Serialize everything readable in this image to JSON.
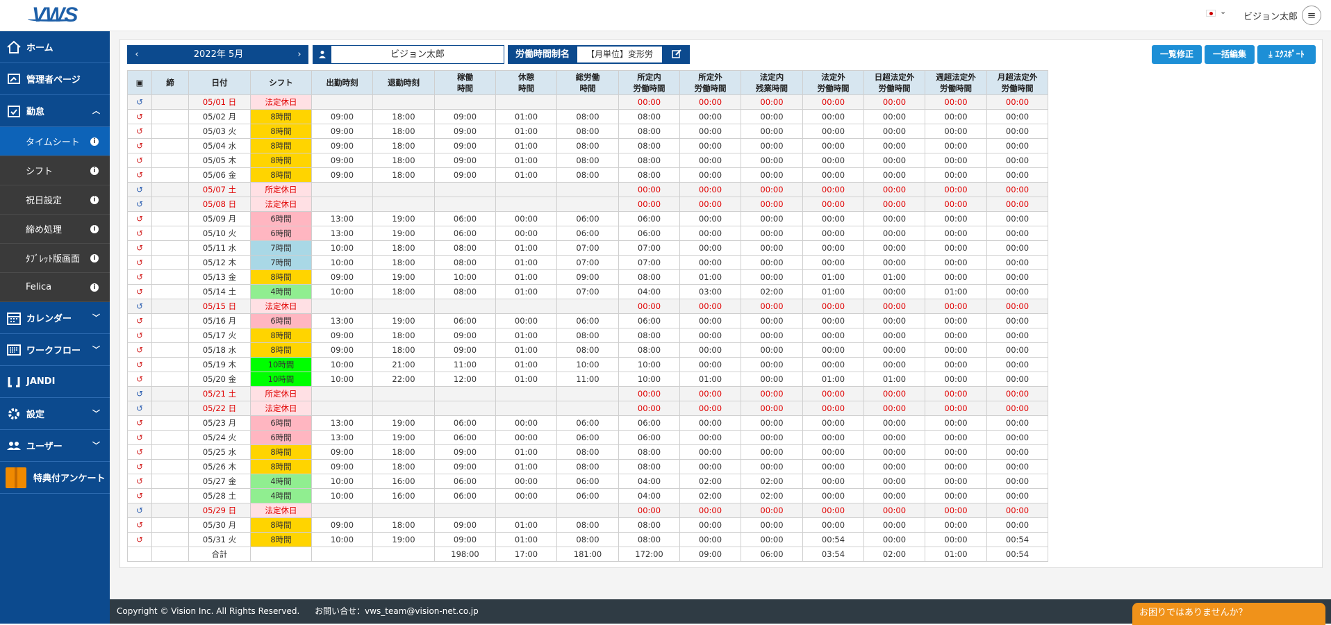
{
  "header": {
    "logo_text": "VWS",
    "username": "ビジョン太郎",
    "menu_icon": "≡"
  },
  "sidebar": {
    "items": [
      {
        "label": "ホーム",
        "icon": "home-icon"
      },
      {
        "label": "管理者ページ",
        "icon": "admin-icon"
      },
      {
        "label": "勤怠",
        "icon": "attendance-icon",
        "expanded": true
      },
      {
        "label": "カレンダー",
        "icon": "calendar-icon"
      },
      {
        "label": "ワークフロー",
        "icon": "workflow-icon"
      },
      {
        "label": "JANDI",
        "icon": "jandi-icon"
      },
      {
        "label": "設定",
        "icon": "gear-icon"
      },
      {
        "label": "ユーザー",
        "icon": "users-icon"
      },
      {
        "label": "特典付アンケート",
        "icon": "gift-icon"
      }
    ],
    "subitems": [
      {
        "label": "タイムシート",
        "active": true
      },
      {
        "label": "シフト"
      },
      {
        "label": "祝日設定"
      },
      {
        "label": "締め処理"
      },
      {
        "label": "ﾀﾌﾞﾚｯﾄ版画面"
      },
      {
        "label": "Felica"
      }
    ]
  },
  "toolbar": {
    "prev": "‹",
    "month": "2022年 5月",
    "next": "›",
    "employee": "ビジョン太郎",
    "system_label": "労働時間制名",
    "system_value": "【月単位】変形労",
    "buttons": {
      "list_edit": "一覧修正",
      "bulk_edit": "一括編集",
      "export": "ｴｸｽﾎﾟｰﾄ"
    }
  },
  "table": {
    "headers": [
      "",
      "締",
      "日付",
      "シフト",
      "出勤時刻",
      "退勤時刻",
      "稼働\n時間",
      "休憩\n時間",
      "総労働\n時間",
      "所定内\n労働時間",
      "所定外\n労働時間",
      "法定内\n残業時間",
      "法定外\n労働時間",
      "日超法定外\n労働時間",
      "週超法定外\n労働時間",
      "月超法定外\n労働時間"
    ],
    "rows": [
      {
        "h": true,
        "d": "05/01 日",
        "s": "法定休日",
        "c": "hol",
        "v": [
          "",
          "",
          "",
          "",
          "",
          "00:00",
          "00:00",
          "00:00",
          "00:00",
          "00:00",
          "00:00",
          "00:00"
        ]
      },
      {
        "d": "05/02 月",
        "s": "8時間",
        "c": "s8",
        "v": [
          "09:00",
          "18:00",
          "09:00",
          "01:00",
          "08:00",
          "08:00",
          "00:00",
          "00:00",
          "00:00",
          "00:00",
          "00:00",
          "00:00"
        ]
      },
      {
        "d": "05/03 火",
        "s": "8時間",
        "c": "s8",
        "v": [
          "09:00",
          "18:00",
          "09:00",
          "01:00",
          "08:00",
          "08:00",
          "00:00",
          "00:00",
          "00:00",
          "00:00",
          "00:00",
          "00:00"
        ]
      },
      {
        "d": "05/04 水",
        "s": "8時間",
        "c": "s8",
        "v": [
          "09:00",
          "18:00",
          "09:00",
          "01:00",
          "08:00",
          "08:00",
          "00:00",
          "00:00",
          "00:00",
          "00:00",
          "00:00",
          "00:00"
        ]
      },
      {
        "d": "05/05 木",
        "s": "8時間",
        "c": "s8",
        "v": [
          "09:00",
          "18:00",
          "09:00",
          "01:00",
          "08:00",
          "08:00",
          "00:00",
          "00:00",
          "00:00",
          "00:00",
          "00:00",
          "00:00"
        ]
      },
      {
        "d": "05/06 金",
        "s": "8時間",
        "c": "s8",
        "v": [
          "09:00",
          "18:00",
          "09:00",
          "01:00",
          "08:00",
          "08:00",
          "00:00",
          "00:00",
          "00:00",
          "00:00",
          "00:00",
          "00:00"
        ]
      },
      {
        "h": true,
        "d": "05/07 土",
        "s": "所定休日",
        "c": "hol",
        "v": [
          "",
          "",
          "",
          "",
          "",
          "00:00",
          "00:00",
          "00:00",
          "00:00",
          "00:00",
          "00:00",
          "00:00"
        ]
      },
      {
        "h": true,
        "d": "05/08 日",
        "s": "法定休日",
        "c": "hol",
        "v": [
          "",
          "",
          "",
          "",
          "",
          "00:00",
          "00:00",
          "00:00",
          "00:00",
          "00:00",
          "00:00",
          "00:00"
        ]
      },
      {
        "d": "05/09 月",
        "s": "6時間",
        "c": "s6",
        "v": [
          "13:00",
          "19:00",
          "06:00",
          "00:00",
          "06:00",
          "06:00",
          "00:00",
          "00:00",
          "00:00",
          "00:00",
          "00:00",
          "00:00"
        ]
      },
      {
        "d": "05/10 火",
        "s": "6時間",
        "c": "s6",
        "v": [
          "13:00",
          "19:00",
          "06:00",
          "00:00",
          "06:00",
          "06:00",
          "00:00",
          "00:00",
          "00:00",
          "00:00",
          "00:00",
          "00:00"
        ]
      },
      {
        "d": "05/11 水",
        "s": "7時間",
        "c": "s7",
        "v": [
          "10:00",
          "18:00",
          "08:00",
          "01:00",
          "07:00",
          "07:00",
          "00:00",
          "00:00",
          "00:00",
          "00:00",
          "00:00",
          "00:00"
        ]
      },
      {
        "d": "05/12 木",
        "s": "7時間",
        "c": "s7",
        "v": [
          "10:00",
          "18:00",
          "08:00",
          "01:00",
          "07:00",
          "07:00",
          "00:00",
          "00:00",
          "00:00",
          "00:00",
          "00:00",
          "00:00"
        ]
      },
      {
        "d": "05/13 金",
        "s": "8時間",
        "c": "s8",
        "v": [
          "09:00",
          "19:00",
          "10:00",
          "01:00",
          "09:00",
          "08:00",
          "01:00",
          "00:00",
          "01:00",
          "01:00",
          "00:00",
          "00:00"
        ]
      },
      {
        "d": "05/14 土",
        "s": "4時間",
        "c": "s4",
        "v": [
          "10:00",
          "18:00",
          "08:00",
          "01:00",
          "07:00",
          "04:00",
          "03:00",
          "02:00",
          "01:00",
          "00:00",
          "01:00",
          "00:00"
        ]
      },
      {
        "h": true,
        "d": "05/15 日",
        "s": "法定休日",
        "c": "hol",
        "v": [
          "",
          "",
          "",
          "",
          "",
          "00:00",
          "00:00",
          "00:00",
          "00:00",
          "00:00",
          "00:00",
          "00:00"
        ]
      },
      {
        "d": "05/16 月",
        "s": "6時間",
        "c": "s6",
        "v": [
          "13:00",
          "19:00",
          "06:00",
          "00:00",
          "06:00",
          "06:00",
          "00:00",
          "00:00",
          "00:00",
          "00:00",
          "00:00",
          "00:00"
        ]
      },
      {
        "d": "05/17 火",
        "s": "8時間",
        "c": "s8",
        "v": [
          "09:00",
          "18:00",
          "09:00",
          "01:00",
          "08:00",
          "08:00",
          "00:00",
          "00:00",
          "00:00",
          "00:00",
          "00:00",
          "00:00"
        ]
      },
      {
        "d": "05/18 水",
        "s": "8時間",
        "c": "s8",
        "v": [
          "09:00",
          "18:00",
          "09:00",
          "01:00",
          "08:00",
          "08:00",
          "00:00",
          "00:00",
          "00:00",
          "00:00",
          "00:00",
          "00:00"
        ]
      },
      {
        "d": "05/19 木",
        "s": "10時間",
        "c": "s10",
        "v": [
          "10:00",
          "21:00",
          "11:00",
          "01:00",
          "10:00",
          "10:00",
          "00:00",
          "00:00",
          "00:00",
          "00:00",
          "00:00",
          "00:00"
        ]
      },
      {
        "d": "05/20 金",
        "s": "10時間",
        "c": "s10",
        "v": [
          "10:00",
          "22:00",
          "12:00",
          "01:00",
          "11:00",
          "10:00",
          "01:00",
          "00:00",
          "01:00",
          "01:00",
          "00:00",
          "00:00"
        ]
      },
      {
        "h": true,
        "d": "05/21 土",
        "s": "所定休日",
        "c": "hol",
        "v": [
          "",
          "",
          "",
          "",
          "",
          "00:00",
          "00:00",
          "00:00",
          "00:00",
          "00:00",
          "00:00",
          "00:00"
        ]
      },
      {
        "h": true,
        "d": "05/22 日",
        "s": "法定休日",
        "c": "hol",
        "v": [
          "",
          "",
          "",
          "",
          "",
          "00:00",
          "00:00",
          "00:00",
          "00:00",
          "00:00",
          "00:00",
          "00:00"
        ]
      },
      {
        "d": "05/23 月",
        "s": "6時間",
        "c": "s6",
        "v": [
          "13:00",
          "19:00",
          "06:00",
          "00:00",
          "06:00",
          "06:00",
          "00:00",
          "00:00",
          "00:00",
          "00:00",
          "00:00",
          "00:00"
        ]
      },
      {
        "d": "05/24 火",
        "s": "6時間",
        "c": "s6",
        "v": [
          "13:00",
          "19:00",
          "06:00",
          "00:00",
          "06:00",
          "06:00",
          "00:00",
          "00:00",
          "00:00",
          "00:00",
          "00:00",
          "00:00"
        ]
      },
      {
        "d": "05/25 水",
        "s": "8時間",
        "c": "s8",
        "v": [
          "09:00",
          "18:00",
          "09:00",
          "01:00",
          "08:00",
          "08:00",
          "00:00",
          "00:00",
          "00:00",
          "00:00",
          "00:00",
          "00:00"
        ]
      },
      {
        "d": "05/26 木",
        "s": "8時間",
        "c": "s8",
        "v": [
          "09:00",
          "18:00",
          "09:00",
          "01:00",
          "08:00",
          "08:00",
          "00:00",
          "00:00",
          "00:00",
          "00:00",
          "00:00",
          "00:00"
        ]
      },
      {
        "d": "05/27 金",
        "s": "4時間",
        "c": "s4",
        "v": [
          "10:00",
          "16:00",
          "06:00",
          "00:00",
          "06:00",
          "04:00",
          "02:00",
          "02:00",
          "00:00",
          "00:00",
          "00:00",
          "00:00"
        ]
      },
      {
        "d": "05/28 土",
        "s": "4時間",
        "c": "s4",
        "v": [
          "10:00",
          "16:00",
          "06:00",
          "00:00",
          "06:00",
          "04:00",
          "02:00",
          "02:00",
          "00:00",
          "00:00",
          "00:00",
          "00:00"
        ]
      },
      {
        "h": true,
        "d": "05/29 日",
        "s": "法定休日",
        "c": "hol",
        "v": [
          "",
          "",
          "",
          "",
          "",
          "00:00",
          "00:00",
          "00:00",
          "00:00",
          "00:00",
          "00:00",
          "00:00"
        ]
      },
      {
        "d": "05/30 月",
        "s": "8時間",
        "c": "s8",
        "v": [
          "09:00",
          "18:00",
          "09:00",
          "01:00",
          "08:00",
          "08:00",
          "00:00",
          "00:00",
          "00:00",
          "00:00",
          "00:00",
          "00:00"
        ]
      },
      {
        "d": "05/31 火",
        "s": "8時間",
        "c": "s8",
        "v": [
          "10:00",
          "19:00",
          "09:00",
          "01:00",
          "08:00",
          "08:00",
          "00:00",
          "00:00",
          "00:54",
          "00:00",
          "00:00",
          "00:54"
        ]
      }
    ],
    "total_label": "合計",
    "totals": [
      "198:00",
      "17:00",
      "181:00",
      "172:00",
      "09:00",
      "06:00",
      "03:54",
      "02:00",
      "01:00",
      "00:54"
    ]
  },
  "footer": {
    "copyright": "Copyright © Vision Inc. All Rights Reserved.",
    "contact": "お問い合せ：vws_team@vision-net.co.jp"
  },
  "help": {
    "label": "お困りではありませんか？"
  }
}
